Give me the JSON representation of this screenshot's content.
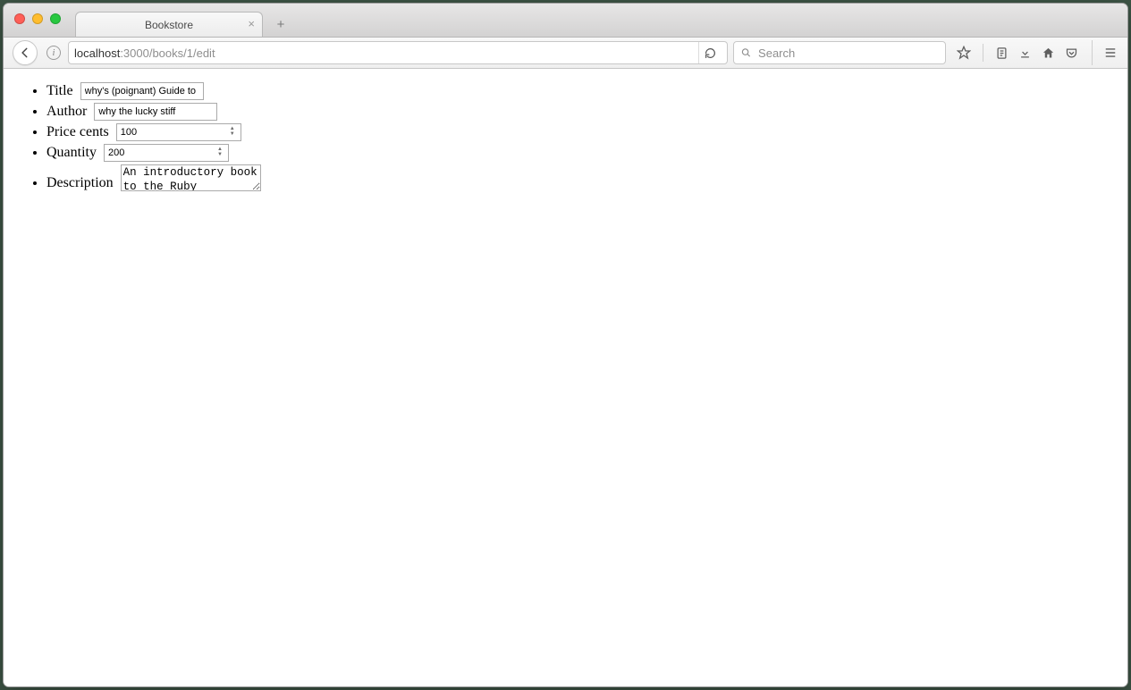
{
  "browser": {
    "tab_title": "Bookstore",
    "url_host": "localhost",
    "url_port_path": ":3000/books/1/edit",
    "search_placeholder": "Search"
  },
  "form": {
    "title": {
      "label": "Title",
      "value": "why's (poignant) Guide to"
    },
    "author": {
      "label": "Author",
      "value": "why the lucky stiff"
    },
    "price_cents": {
      "label": "Price cents",
      "value": "100"
    },
    "quantity": {
      "label": "Quantity",
      "value": "200"
    },
    "description": {
      "label": "Description",
      "value": "An introductory book to the Ruby"
    }
  }
}
